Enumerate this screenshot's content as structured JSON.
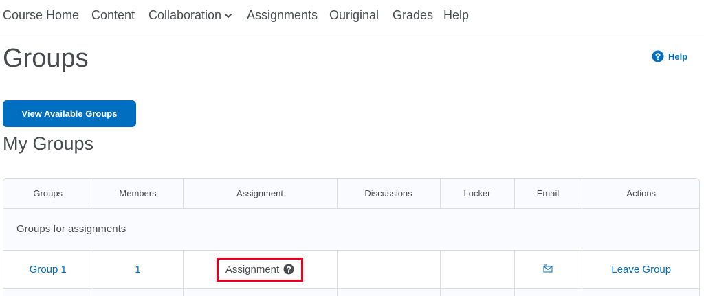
{
  "nav": {
    "items": [
      {
        "label": "Course Home"
      },
      {
        "label": "Content"
      },
      {
        "label": "Collaboration",
        "has_dropdown": true
      },
      {
        "label": "Assignments"
      },
      {
        "label": "Ouriginal"
      },
      {
        "label": "Grades"
      },
      {
        "label": "Help"
      }
    ]
  },
  "page": {
    "title": "Groups",
    "help_label": "Help",
    "help_icon": "question-circle-icon",
    "view_groups_button": "View Available Groups",
    "section_title": "My Groups"
  },
  "table": {
    "columns": [
      "Groups",
      "Members",
      "Assignment",
      "Discussions",
      "Locker",
      "Email",
      "Actions"
    ],
    "group_heading": "Groups for assignments",
    "rows": [
      {
        "group": "Group 1",
        "members": "1",
        "assignment": "Assignment",
        "assignment_icon": "question-circle-icon",
        "discussions": "",
        "locker": "",
        "email_icon": "email-icon",
        "action": "Leave Group"
      }
    ]
  },
  "colors": {
    "accent": "#006fbf",
    "text": "#494c4e",
    "highlight_border": "#e2001a",
    "header_bg": "#f9fbff"
  }
}
